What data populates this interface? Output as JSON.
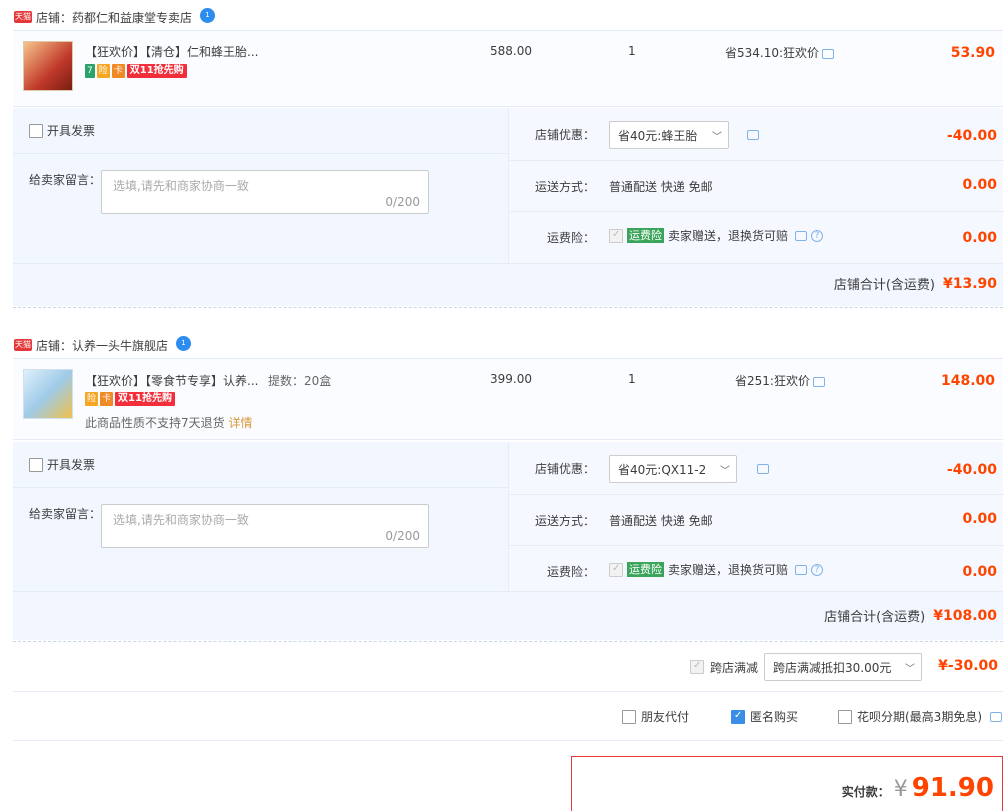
{
  "tmall_badge": "天猫",
  "shops": [
    {
      "shop_label": "店铺：药都仁和益康堂专卖店",
      "ww_badge": "1",
      "product": {
        "title": "【狂欢价】【清仓】仁和蜂王胎...",
        "sku": "",
        "price": "588.00",
        "qty": "1",
        "discount": "省534.10:狂欢价",
        "subtotal": "53.90",
        "tags": [
          "7",
          "险",
          "卡",
          "双11抢先购"
        ],
        "note": "",
        "note_link": ""
      },
      "invoice_label": "开具发票",
      "message_label": "给卖家留言：",
      "message_placeholder": "选填,请先和商家协商一致",
      "message_counter": "0/200",
      "coupon_label": "店铺优惠：",
      "coupon_value": "省40元:蜂王胎",
      "coupon_amount": "-40.00",
      "shipping_label": "运送方式：",
      "shipping_value": "普通配送 快递 免邮",
      "shipping_amount": "0.00",
      "insurance_label": "运费险：",
      "insurance_tag": "运费险",
      "insurance_text": "卖家赠送，退换货可赔",
      "insurance_amount": "0.00",
      "total_label": "店铺合计(含运费)",
      "total_value": "¥13.90"
    },
    {
      "shop_label": "店铺：认养一头牛旗舰店",
      "ww_badge": "1",
      "product": {
        "title": "【狂欢价】【零食节专享】认养...",
        "sku": "提数：20盒",
        "price": "399.00",
        "qty": "1",
        "discount": "省251:狂欢价",
        "subtotal": "148.00",
        "tags": [
          "险",
          "卡",
          "双11抢先购"
        ],
        "note": "此商品性质不支持7天退货",
        "note_link": "详情"
      },
      "invoice_label": "开具发票",
      "message_label": "给卖家留言：",
      "message_placeholder": "选填,请先和商家协商一致",
      "message_counter": "0/200",
      "coupon_label": "店铺优惠：",
      "coupon_value": "省40元:QX11-2",
      "coupon_amount": "-40.00",
      "shipping_label": "运送方式：",
      "shipping_value": "普通配送 快递 免邮",
      "shipping_amount": "0.00",
      "insurance_label": "运费险：",
      "insurance_tag": "运费险",
      "insurance_text": "卖家赠送，退换货可赔",
      "insurance_amount": "0.00",
      "total_label": "店铺合计(含运费)",
      "total_value": "¥108.00"
    }
  ],
  "cross_store": {
    "label": "跨店满减",
    "select_value": "跨店满减抵扣30.00元",
    "amount": "¥-30.00"
  },
  "options": {
    "friend_pay": "朋友代付",
    "anonymous": "匿名购买",
    "huabei": "花呗分期(最高3期免息)"
  },
  "payment": {
    "label": "实付款：",
    "currency": "¥",
    "amount": "91.90"
  },
  "colors": {
    "accent_red": "#ff4400",
    "panel_bg": "#f2f7ff",
    "pay_border": "#e4393c"
  }
}
